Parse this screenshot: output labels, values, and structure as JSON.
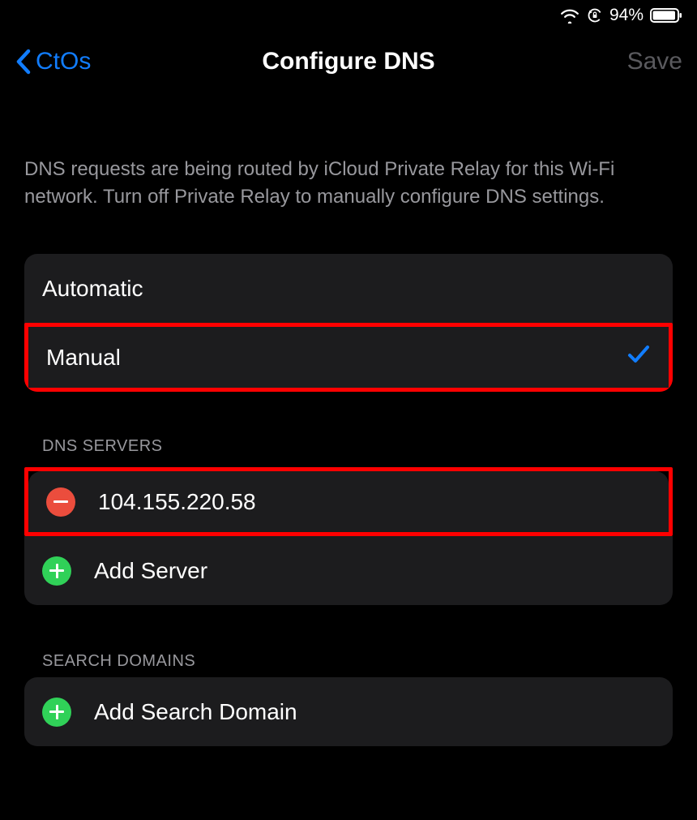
{
  "status": {
    "battery_percent": "94%"
  },
  "nav": {
    "back_label": "CtOs",
    "title": "Configure DNS",
    "save_label": "Save"
  },
  "info_text": "DNS requests are being routed by iCloud Private Relay for this Wi-Fi network. Turn off Private Relay to manually configure DNS settings.",
  "dns_mode": {
    "options": {
      "automatic": "Automatic",
      "manual": "Manual"
    },
    "selected": "manual"
  },
  "sections": {
    "dns_servers_header": "DNS SERVERS",
    "search_domains_header": "SEARCH DOMAINS"
  },
  "dns_servers": {
    "entries": [
      {
        "ip": "104.155.220.58"
      }
    ],
    "add_label": "Add Server"
  },
  "search_domains": {
    "add_label": "Add Search Domain"
  },
  "highlights": {
    "manual_row": true,
    "first_server_row": true
  },
  "colors": {
    "accent_blue": "#117dff",
    "delete_red": "#eb4d3d",
    "add_green": "#30d158",
    "highlight_red": "#ff0000"
  }
}
